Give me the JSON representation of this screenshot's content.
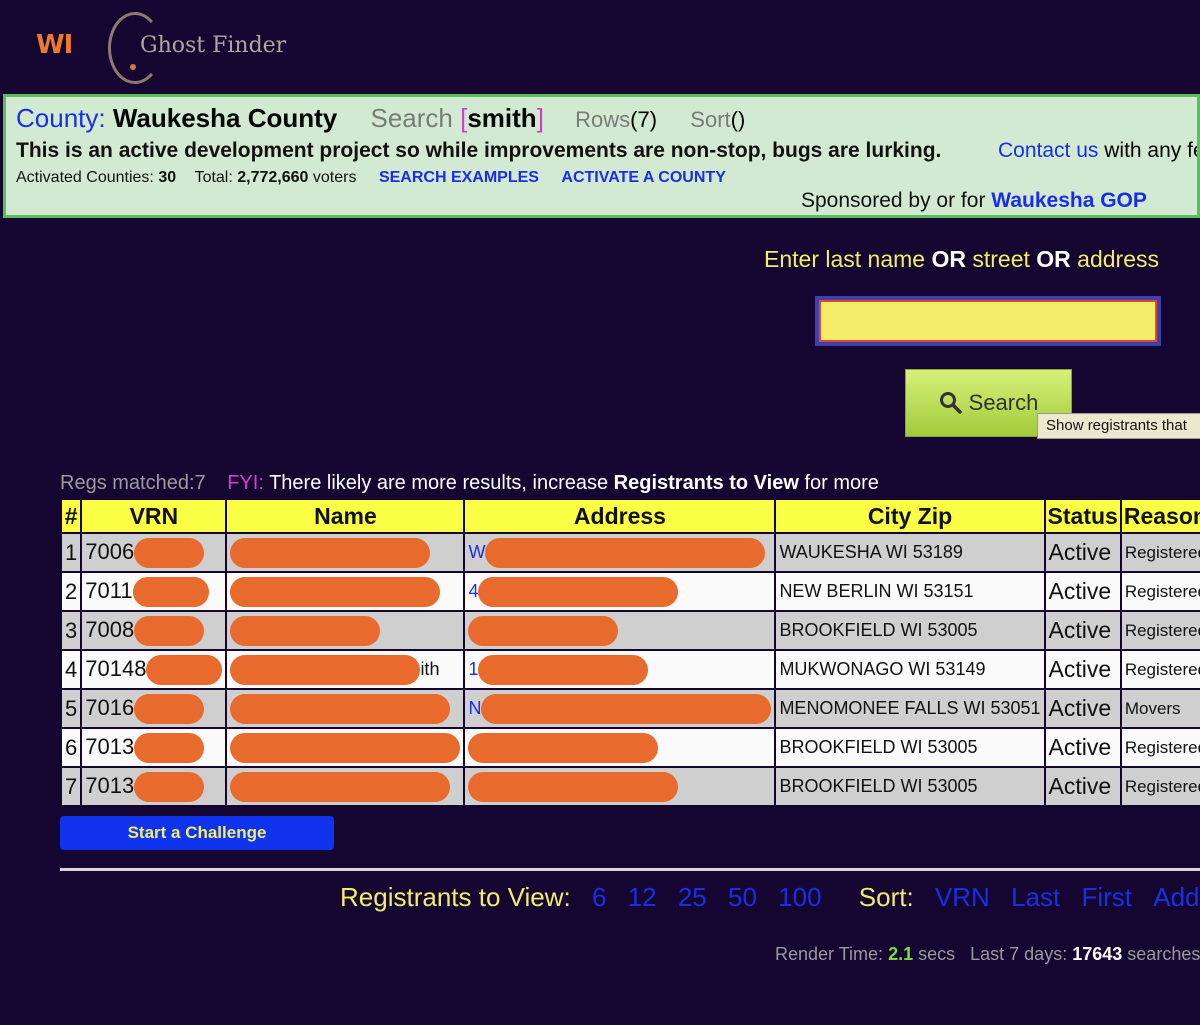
{
  "header": {
    "state": "WI",
    "app_name": "Ghost Finder"
  },
  "info": {
    "county_label": "County:",
    "county_value": "Waukesha County",
    "search_label": "Search",
    "search_open": "[",
    "search_value": "smith",
    "search_close": "]",
    "rows_label": "Rows",
    "rows_value": "(7)",
    "sort_label": "Sort",
    "sort_value": "()",
    "notice": "This is an active development project so while improvements are non-stop, bugs are lurking.",
    "contact_link": "Contact us",
    "contact_rest": "with any feedback",
    "activated_label": "Activated Counties:",
    "activated_value": "30",
    "total_label": "Total:",
    "total_value": "2,772,660",
    "total_unit": "voters",
    "search_examples": "SEARCH EXAMPLES",
    "activate_county": "ACTIVATE A COUNTY",
    "sponsor_text": "Sponsored by or for",
    "sponsor_link": "Waukesha GOP"
  },
  "search": {
    "prompt_1": "Enter last name ",
    "prompt_or1": "OR",
    "prompt_2": " street ",
    "prompt_or2": "OR",
    "prompt_3": " address",
    "input_value": "",
    "button_label": "Search",
    "tooltip": "Show registrants that"
  },
  "results_meta": {
    "matched_label": "Regs matched:",
    "matched_value": "7",
    "fyi_label": "FYI:",
    "fyi_text_1": "There likely are more results, increase ",
    "fyi_bold": "Registrants to View",
    "fyi_text_2": " for more"
  },
  "table": {
    "headers": [
      "#",
      "VRN",
      "Name",
      "Address",
      "City Zip",
      "Status",
      "Reason"
    ],
    "rows": [
      {
        "num": "1",
        "vrn": "7006",
        "name_tail": "",
        "address_head": "W",
        "city_zip": "WAUKESHA WI 53189",
        "status": "Active",
        "reason": "Registered"
      },
      {
        "num": "2",
        "vrn": "7011",
        "name_tail": "",
        "address_head": "4",
        "city_zip": "NEW BERLIN WI 53151",
        "status": "Active",
        "reason": "Registered"
      },
      {
        "num": "3",
        "vrn": "7008",
        "name_tail": "",
        "address_head": "",
        "city_zip": "BROOKFIELD WI 53005",
        "status": "Active",
        "reason": "Registered"
      },
      {
        "num": "4",
        "vrn": "70148",
        "name_tail": "ith",
        "address_head": "1",
        "city_zip": "MUKWONAGO WI 53149",
        "status": "Active",
        "reason": "Registered"
      },
      {
        "num": "5",
        "vrn": "7016",
        "name_tail": "",
        "address_head": "N",
        "city_zip": "MENOMONEE FALLS WI 53051",
        "status": "Active",
        "reason": "Movers"
      },
      {
        "num": "6",
        "vrn": "7013",
        "name_tail": "",
        "address_head": "",
        "city_zip": "BROOKFIELD WI 53005",
        "status": "Active",
        "reason": "Registered"
      },
      {
        "num": "7",
        "vrn": "7013",
        "name_tail": "",
        "address_head": "",
        "city_zip": "BROOKFIELD WI 53005",
        "status": "Active",
        "reason": "Registered"
      }
    ]
  },
  "actions": {
    "challenge_label": "Start a Challenge"
  },
  "pager": {
    "label": "Registrants to View:",
    "options": [
      "6",
      "12",
      "25",
      "50",
      "100"
    ],
    "sort_label": "Sort:",
    "sort_options": [
      "VRN",
      "Last",
      "First",
      "Address"
    ]
  },
  "footer": {
    "render_label": "Render Time:",
    "render_value": "2.1",
    "render_unit": "secs",
    "days_label": "Last 7 days:",
    "days_value": "17643",
    "days_unit": "searches"
  },
  "colors": {
    "background": "#140630",
    "panel_bg": "#d3ead2",
    "panel_border": "#5bbf58",
    "link_blue": "#1a2ee6",
    "accent_yellow": "#f1ed6a",
    "header_yellow": "#fafe44",
    "redaction": "#e86a2c"
  }
}
